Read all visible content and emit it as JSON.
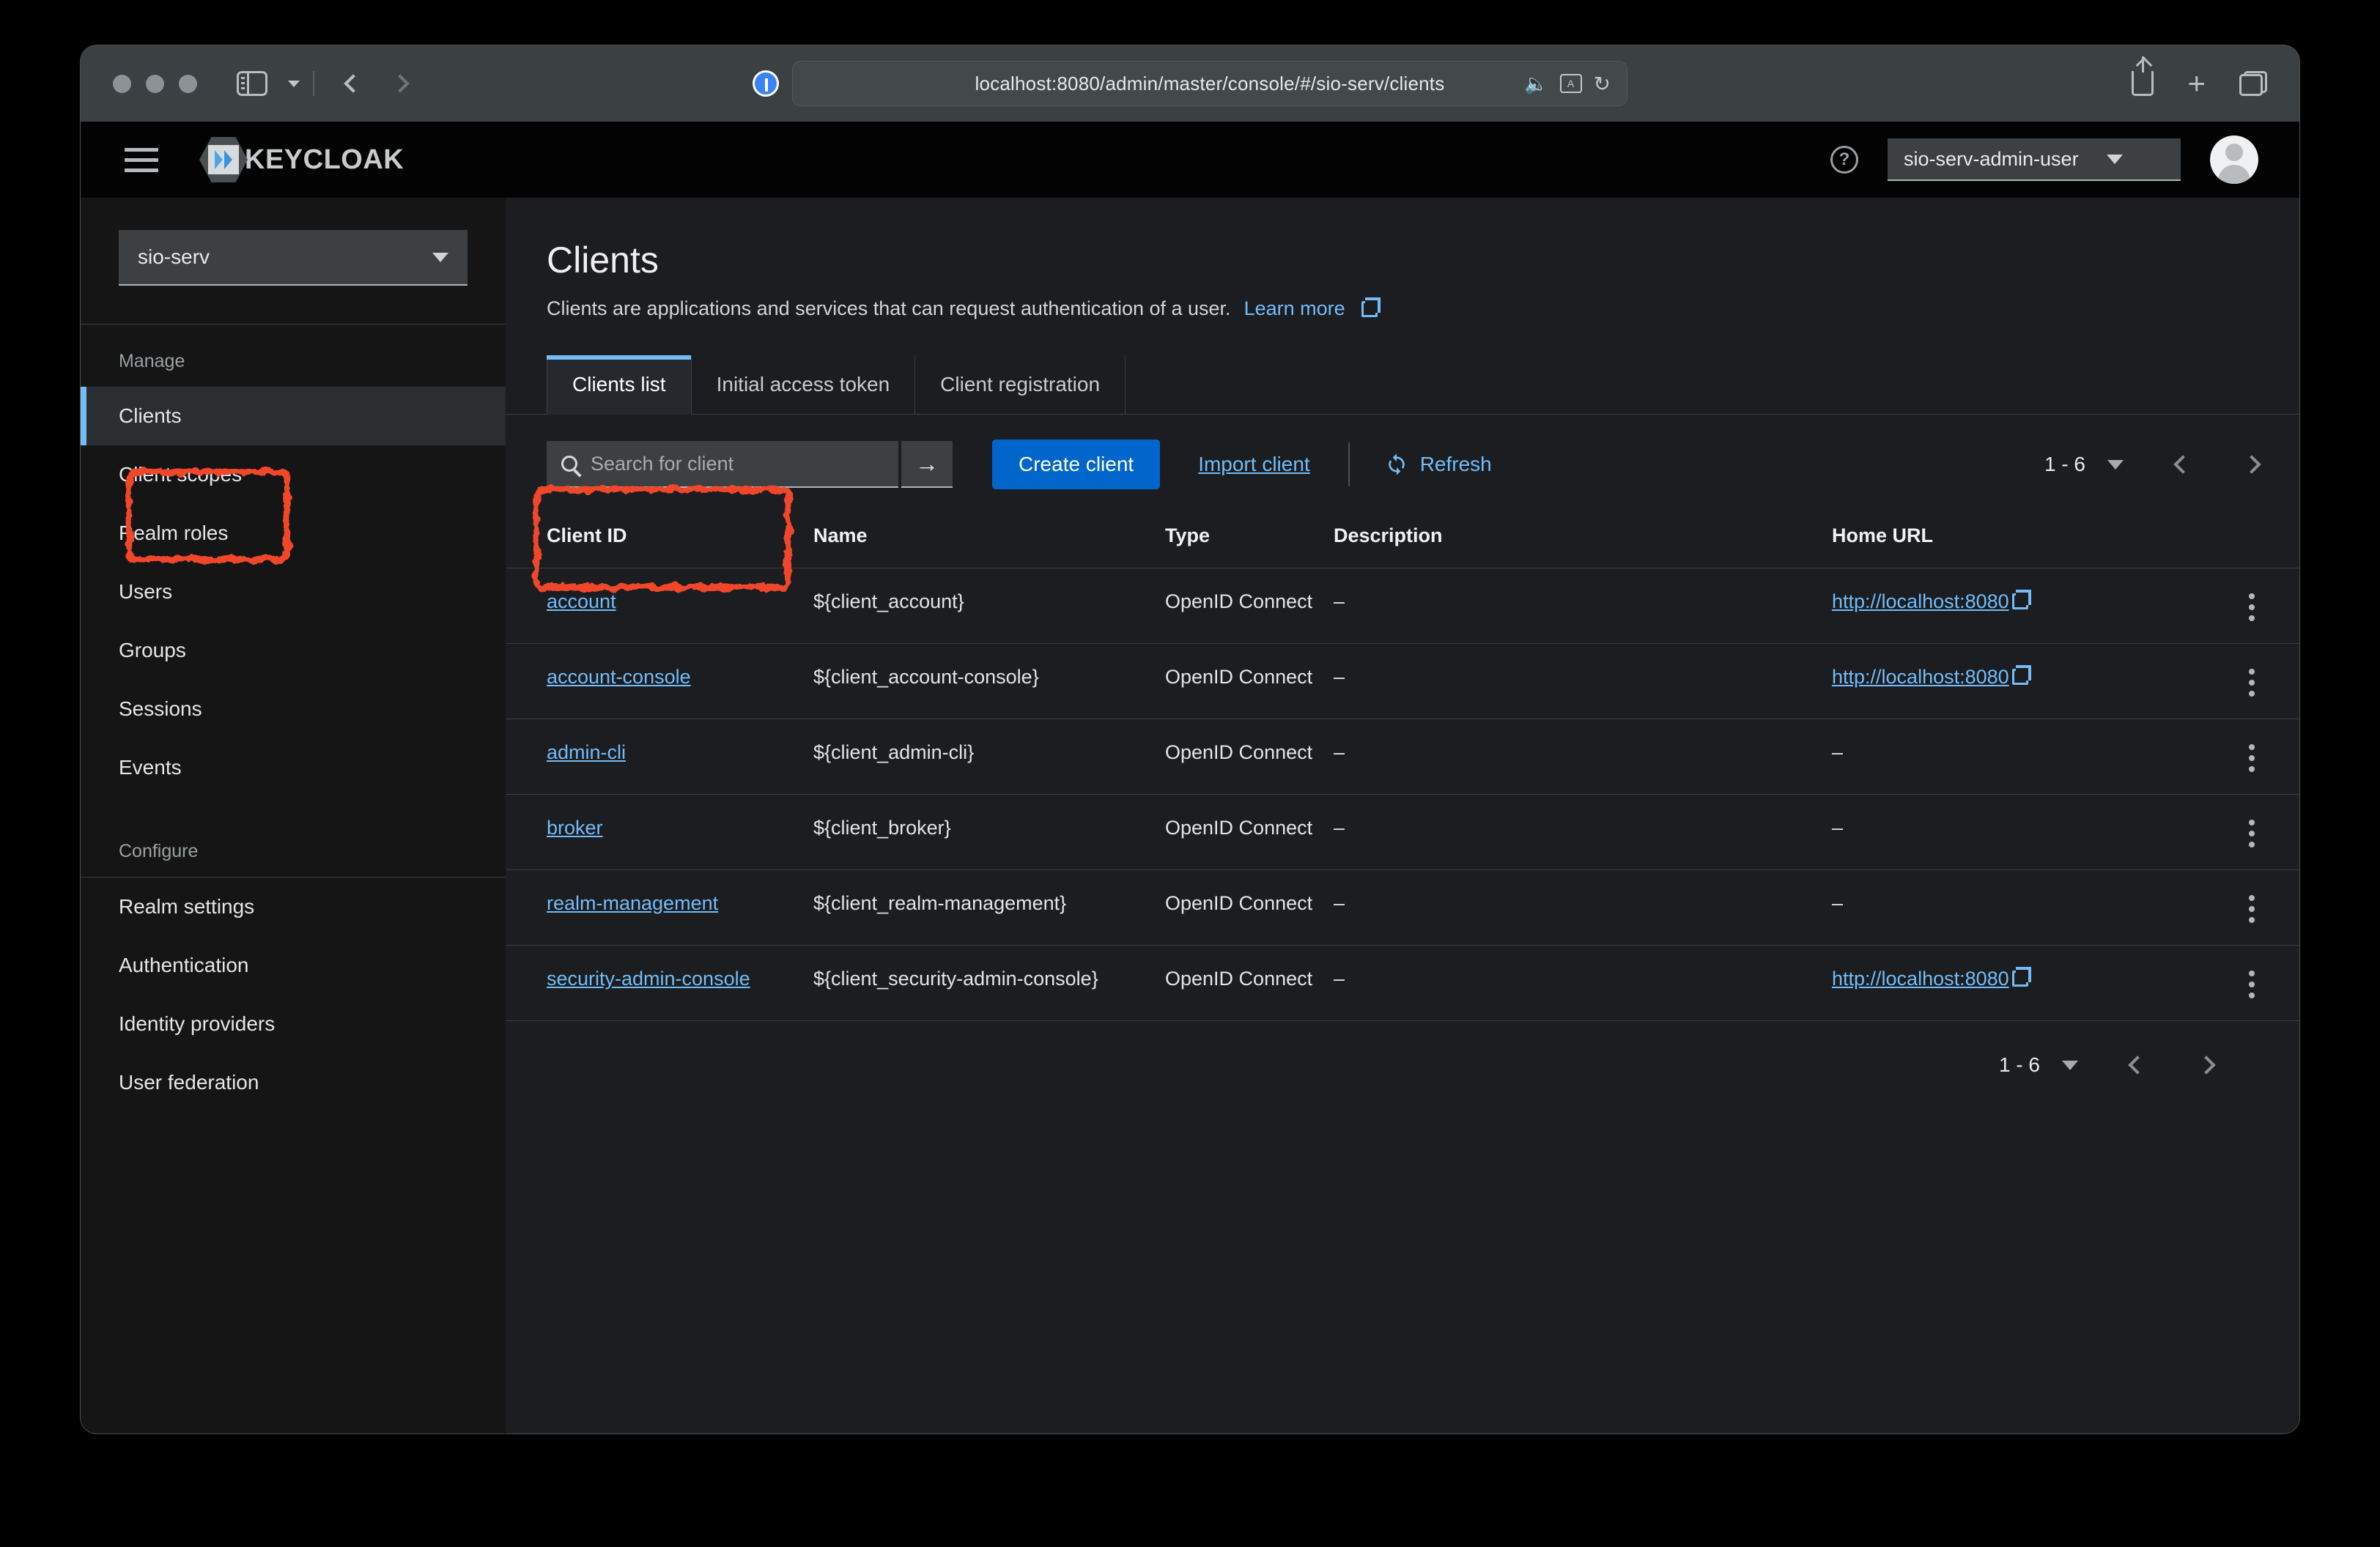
{
  "browser": {
    "url": "localhost:8080/admin/master/console/#/sio-serv/clients",
    "icons": {
      "sidebar_toggle": "sidebar-toggle-icon",
      "back": "back-chevron-icon",
      "forward": "forward-chevron-icon",
      "reader": "reader-mode-icon",
      "speaker": "speaker-icon",
      "translate": "translate-icon",
      "reload": "reload-icon",
      "share": "share-icon",
      "new_tab": "plus-icon",
      "tab_overview": "tab-overview-icon"
    }
  },
  "masthead": {
    "menu_icon": "hamburger-icon",
    "brand": "KEYCLOAK",
    "help_icon": "help-circle-icon",
    "user": "sio-serv-admin-user",
    "avatar": "user-avatar-icon"
  },
  "sidebar": {
    "realm": "sio-serv",
    "sections": [
      {
        "label": "Manage",
        "items": [
          {
            "label": "Clients",
            "active": true
          },
          {
            "label": "Client scopes",
            "active": false
          },
          {
            "label": "Realm roles",
            "active": false
          },
          {
            "label": "Users",
            "active": false
          },
          {
            "label": "Groups",
            "active": false
          },
          {
            "label": "Sessions",
            "active": false
          },
          {
            "label": "Events",
            "active": false
          }
        ]
      },
      {
        "label": "Configure",
        "items": [
          {
            "label": "Realm settings",
            "active": false
          },
          {
            "label": "Authentication",
            "active": false
          },
          {
            "label": "Identity providers",
            "active": false
          },
          {
            "label": "User federation",
            "active": false
          }
        ]
      }
    ]
  },
  "main": {
    "title": "Clients",
    "subtitle": "Clients are applications and services that can request authentication of a user.",
    "learn_more": "Learn more",
    "tabs": [
      {
        "label": "Clients list",
        "active": true
      },
      {
        "label": "Initial access token",
        "active": false
      },
      {
        "label": "Client registration",
        "active": false
      }
    ],
    "toolbar": {
      "search_placeholder": "Search for client",
      "search_value": "",
      "search_go_icon": "arrow-right-icon",
      "create_client": "Create client",
      "import_client": "Import client",
      "refresh": "Refresh",
      "refresh_icon": "refresh-sync-icon"
    },
    "pagination": {
      "range": "1 - 6",
      "prev_icon": "chevron-left-icon",
      "next_icon": "chevron-right-icon"
    },
    "table": {
      "columns": [
        "Client ID",
        "Name",
        "Type",
        "Description",
        "Home URL"
      ],
      "rows": [
        {
          "client_id": "account",
          "name": "${client_account}",
          "type": "OpenID Connect",
          "description": "–",
          "home_url": "http://localhost:8080"
        },
        {
          "client_id": "account-console",
          "name": "${client_account-console}",
          "type": "OpenID Connect",
          "description": "–",
          "home_url": "http://localhost:8080"
        },
        {
          "client_id": "admin-cli",
          "name": "${client_admin-cli}",
          "type": "OpenID Connect",
          "description": "–",
          "home_url": "–"
        },
        {
          "client_id": "broker",
          "name": "${client_broker}",
          "type": "OpenID Connect",
          "description": "–",
          "home_url": "–"
        },
        {
          "client_id": "realm-management",
          "name": "${client_realm-management}",
          "type": "OpenID Connect",
          "description": "–",
          "home_url": "–"
        },
        {
          "client_id": "security-admin-console",
          "name": "${client_security-admin-console}",
          "type": "OpenID Connect",
          "description": "–",
          "home_url": "http://localhost:8080"
        }
      ]
    }
  },
  "annotations": [
    {
      "target": "sidebar-item-clients",
      "color": "#f0472a"
    },
    {
      "target": "create-client-button",
      "color": "#f0472a"
    }
  ],
  "colors": {
    "accent_blue": "#0066cc",
    "link_blue": "#73bcf7",
    "annotation_red": "#f0472a",
    "page_bg": "#1b1d21",
    "sidebar_bg": "#151515"
  }
}
